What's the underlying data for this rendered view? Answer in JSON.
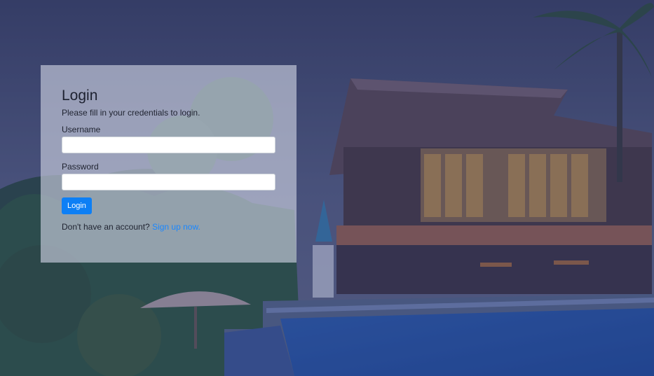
{
  "login": {
    "title": "Login",
    "subtitle": "Please fill in your credentials to login.",
    "username_label": "Username",
    "username_value": "",
    "password_label": "Password",
    "password_value": "",
    "button_label": "Login",
    "signup_prompt": "Don't have an account?",
    "signup_link": "Sign up now."
  },
  "colors": {
    "accent": "#0d7ff5",
    "link": "#1a87ff",
    "panel": "rgba(200,205,222,0.66)"
  },
  "background": {
    "icon": "resort-pool-background-image"
  }
}
